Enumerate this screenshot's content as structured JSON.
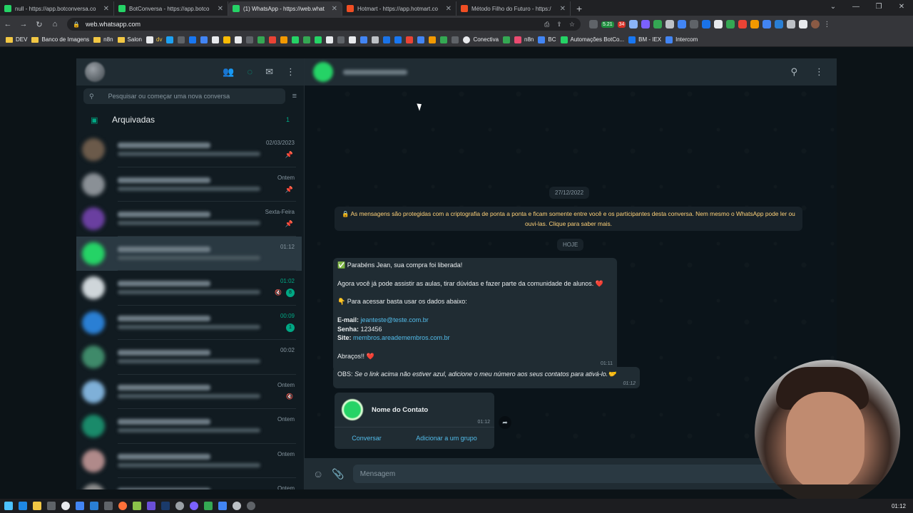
{
  "browser": {
    "tabs": [
      {
        "label": "null - https://app.botconversa.co",
        "color": "#25d366",
        "active": false
      },
      {
        "label": "BotConversa - https://app.botco",
        "color": "#25d366",
        "active": false
      },
      {
        "label": "(1) WhatsApp - https://web.what",
        "color": "#25d366",
        "active": true
      },
      {
        "label": "Hotmart - https://app.hotmart.co",
        "color": "#f04e23",
        "active": false
      },
      {
        "label": "Método Filho do Futuro - https:/",
        "color": "#f04e23",
        "active": false
      }
    ],
    "new_tab": "+",
    "url": "web.whatsapp.com",
    "ext_badges": [
      "5.21",
      "34"
    ],
    "bookmarks": [
      "DEV",
      "Banco de Imagens",
      "n8n",
      "Salon",
      "dv",
      "Conectiva",
      "n8n",
      "BC",
      "Automações BotCo...",
      "BM - IEX",
      "Intercom"
    ]
  },
  "whatsapp": {
    "search_placeholder": "Pesquisar ou começar uma nova conversa",
    "archived_label": "Arquivadas",
    "archived_count": "1",
    "chats": [
      {
        "time": "02/03/2023",
        "pinned": true,
        "avatar": "#6b5a4a"
      },
      {
        "time": "Ontem",
        "pinned": true,
        "avatar": "#8a9096"
      },
      {
        "time": "Sexta-Feira",
        "pinned": true,
        "avatar": "#6a3fa0"
      },
      {
        "time": "01:12",
        "selected": true,
        "avatar": "#25d366"
      },
      {
        "time": "01:02",
        "green": true,
        "badge": "8",
        "muted": true,
        "avatar": "#cfd6da"
      },
      {
        "time": "00:09",
        "green": true,
        "badge": "1",
        "avatar": "#2a7fd4"
      },
      {
        "time": "00:02",
        "avatar": "#3f8a6a"
      },
      {
        "time": "Ontem",
        "muted": true,
        "avatar": "#7fb0d8"
      },
      {
        "time": "Ontem",
        "avatar": "#1a8a6a"
      },
      {
        "time": "Ontem",
        "avatar": "#b08a8a"
      },
      {
        "time": "Ontem",
        "avatar": "#8c8c8c"
      }
    ],
    "date_pill": "27/12/2022",
    "encryption_note": "🔒 As mensagens são protegidas com a criptografia de ponta a ponta e ficam somente entre você e os participantes desta conversa. Nem mesmo o WhatsApp pode ler ou ouvi-las. Clique para saber mais.",
    "today_pill": "HOJE",
    "message1": {
      "l1": "✅ Parabéns Jean, sua compra foi liberada!",
      "l2": "Agora você já pode assistir as aulas, tirar dúvidas e fazer parte da comunidade de alunos. ❤️",
      "l3": "👇 Para acessar basta usar os dados abaixo:",
      "email_label": "E-mail:",
      "email_value": "jeanteste@teste.com.br",
      "senha_label": "Senha:",
      "senha_value": "123456",
      "site_label": "Site:",
      "site_value": "membros.areademembros.com.br",
      "closing": "Abraços!! ❤️",
      "time": "01:11"
    },
    "message2": {
      "label": "OBS:",
      "text": "Se o link acima não estiver azul, adicione o meu número aos seus contatos para ativá-lo.🤝",
      "time": "01:12"
    },
    "contact_card": {
      "name": "Nome do Contato",
      "time": "01:12",
      "action1": "Conversar",
      "action2": "Adicionar a um grupo"
    },
    "composer_placeholder": "Mensagem"
  },
  "taskbar": {
    "clock": "01:12"
  },
  "colors": {
    "accent": "#00a884",
    "link": "#53bdeb",
    "bubble": "#202c33",
    "panel": "#111b21"
  }
}
